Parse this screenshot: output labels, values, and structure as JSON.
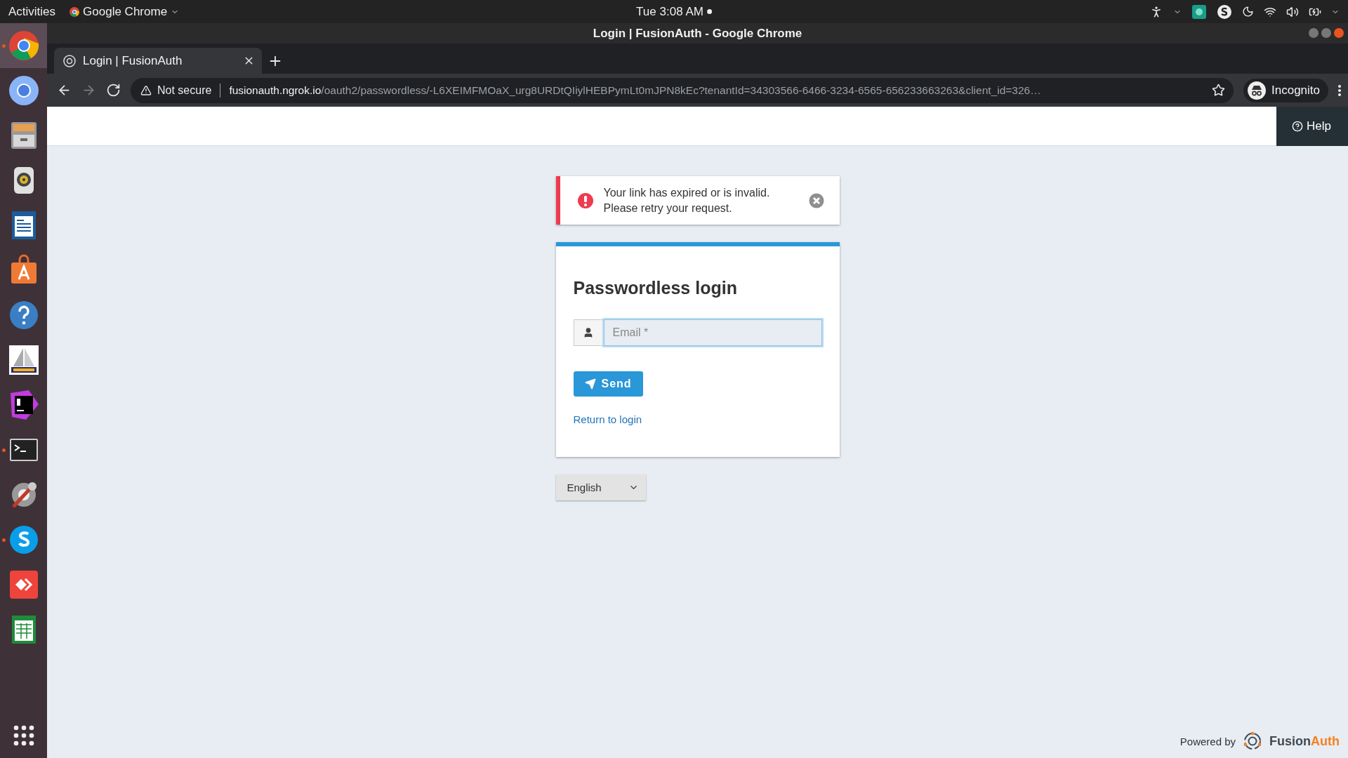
{
  "top_bar": {
    "activities": "Activities",
    "app_menu": "Google Chrome",
    "clock": "Tue  3:08 AM"
  },
  "dock": [
    {
      "kind": "chrome",
      "running": true,
      "selected": true
    },
    {
      "kind": "chromium",
      "running": false,
      "selected": false
    },
    {
      "kind": "files",
      "running": false,
      "selected": false
    },
    {
      "kind": "speaker",
      "running": false,
      "selected": false
    },
    {
      "kind": "writer",
      "running": false,
      "selected": false
    },
    {
      "kind": "store",
      "running": false,
      "selected": false
    },
    {
      "kind": "help",
      "running": false,
      "selected": false
    },
    {
      "kind": "sail",
      "running": false,
      "selected": false
    },
    {
      "kind": "ide",
      "running": false,
      "selected": false
    },
    {
      "kind": "terminal",
      "running": true,
      "selected": false
    },
    {
      "kind": "tools",
      "running": false,
      "selected": false
    },
    {
      "kind": "chat",
      "running": true,
      "selected": false
    },
    {
      "kind": "remote",
      "running": false,
      "selected": false
    },
    {
      "kind": "calc",
      "running": false,
      "selected": false
    }
  ],
  "window": {
    "title": "Login | FusionAuth - Google Chrome"
  },
  "tabs": [
    {
      "label": "Login | FusionAuth",
      "selected": true
    }
  ],
  "toolbar": {
    "nav": [
      {
        "kind": "back",
        "disabled": false
      },
      {
        "kind": "forward",
        "disabled": true
      },
      {
        "kind": "reload",
        "disabled": false
      }
    ],
    "security": "Not secure",
    "url_host": "fusionauth.ngrok.io",
    "url_path": "/oauth2/passwordless/-L6XEIMFMOaX_urg8URDtQIiylHEBPymLt0mJPN8kEc?tenantId=34303566-6466-3234-6565-656233663263&client_id=326…",
    "profile": "Incognito"
  },
  "header": {
    "help": "Help"
  },
  "alert": {
    "lines": [
      "Your link has expired or is invalid.",
      "Please retry your request."
    ]
  },
  "form": {
    "title": "Passwordless login",
    "email": {
      "placeholder": "Email *",
      "focused": true
    },
    "submit": "Send",
    "link": "Return to login"
  },
  "language": {
    "value": "English"
  },
  "footer": {
    "powered_by": "Powered by",
    "logo": [
      {
        "text": "Fusion",
        "color": "#3f4a53"
      },
      {
        "text": "Auth",
        "color": "#f58220"
      }
    ]
  }
}
